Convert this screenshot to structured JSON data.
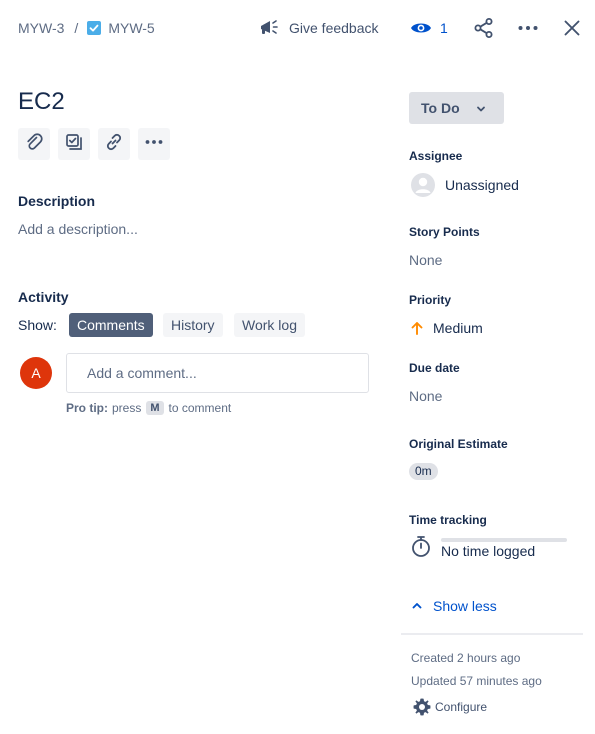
{
  "breadcrumb": {
    "parent": "MYW-3",
    "separator": "/",
    "current": "MYW-5"
  },
  "header": {
    "feedback_label": "Give feedback",
    "watch_count": "1"
  },
  "issue": {
    "title": "EC2"
  },
  "description": {
    "heading": "Description",
    "placeholder": "Add a description..."
  },
  "activity": {
    "heading": "Activity",
    "show_label": "Show:",
    "tabs": [
      {
        "label": "Comments",
        "active": true
      },
      {
        "label": "History",
        "active": false
      },
      {
        "label": "Work log",
        "active": false
      }
    ],
    "avatar_initial": "A",
    "comment_placeholder": "Add a comment...",
    "protip_bold": "Pro tip:",
    "protip_press": "press",
    "protip_key": "M",
    "protip_rest": "to comment"
  },
  "sidebar": {
    "status": "To Do",
    "assignee_label": "Assignee",
    "assignee_value": "Unassigned",
    "story_points_label": "Story Points",
    "story_points_value": "None",
    "priority_label": "Priority",
    "priority_value": "Medium",
    "due_date_label": "Due date",
    "due_date_value": "None",
    "original_estimate_label": "Original Estimate",
    "original_estimate_value": "0m",
    "time_tracking_label": "Time tracking",
    "time_tracking_value": "No time logged",
    "show_less": "Show less",
    "created": "Created 2 hours ago",
    "updated": "Updated 57 minutes ago",
    "configure": "Configure"
  },
  "colors": {
    "accent": "#0052cc",
    "avatar": "#de350b",
    "priority": "#ff8b00",
    "status_bg": "#dfe1e6"
  }
}
